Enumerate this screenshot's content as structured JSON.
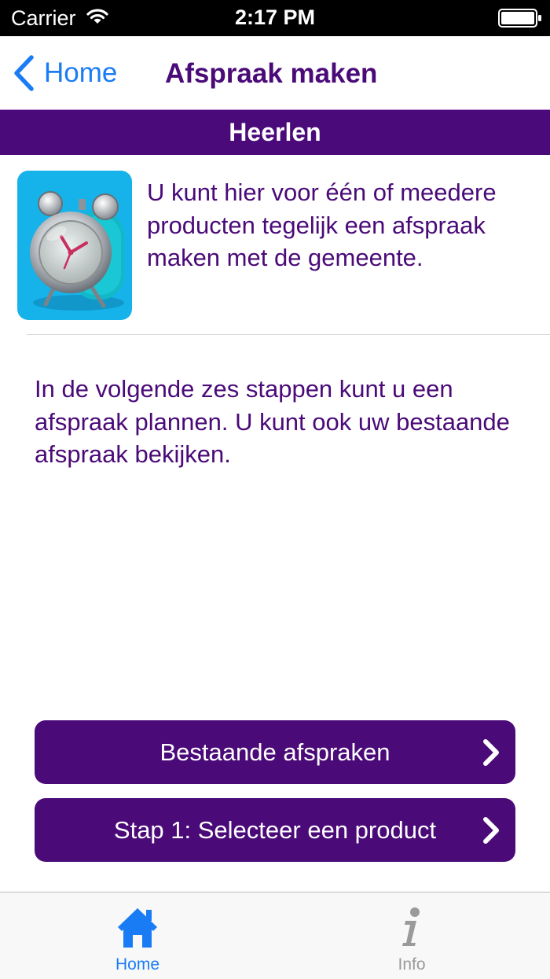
{
  "status_bar": {
    "carrier": "Carrier",
    "time": "2:17 PM",
    "icons": [
      "wifi-icon",
      "battery-icon"
    ]
  },
  "nav": {
    "back_label": "Home",
    "title": "Afspraak maken"
  },
  "city": "Heerlen",
  "intro": {
    "icon": "alarm-clock-icon",
    "text": "U kunt hier voor één of meedere producten tegelijk een afspraak maken met de gemeente."
  },
  "steps_text": "In de volgende zes stappen kunt u een afspraak plannen. U kunt ook uw bestaande afspraak bekijken.",
  "buttons": [
    {
      "label": "Bestaande afspraken"
    },
    {
      "label": "Stap 1: Selecteer een product"
    }
  ],
  "tabs": [
    {
      "label": "Home",
      "icon": "home-icon",
      "selected": true
    },
    {
      "label": "Info",
      "icon": "info-icon",
      "selected": false
    }
  ],
  "colors": {
    "accent": "#4a0a78",
    "link": "#1a7cf5",
    "icon_bg": "#16b3ea",
    "tab_inactive": "#9a9a9a"
  }
}
